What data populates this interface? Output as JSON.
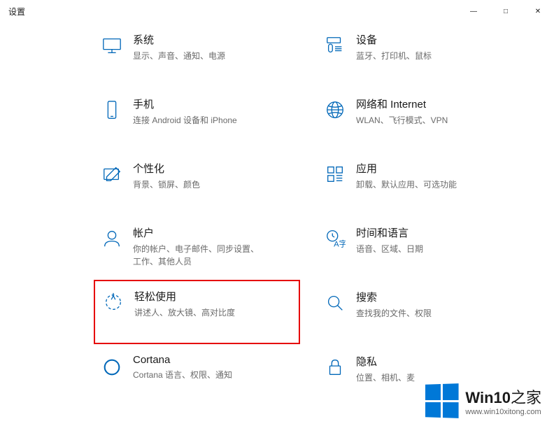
{
  "window_title": "设置",
  "window_controls": {
    "min": "—",
    "max": "□",
    "close": "✕"
  },
  "tiles": {
    "system": {
      "title": "系统",
      "desc": "显示、声音、通知、电源"
    },
    "devices": {
      "title": "设备",
      "desc": "蓝牙、打印机、鼠标"
    },
    "phone": {
      "title": "手机",
      "desc": "连接 Android 设备和 iPhone"
    },
    "network": {
      "title": "网络和 Internet",
      "desc": "WLAN、飞行模式、VPN"
    },
    "personalize": {
      "title": "个性化",
      "desc": "背景、锁屏、颜色"
    },
    "apps": {
      "title": "应用",
      "desc": "卸载、默认应用、可选功能"
    },
    "accounts": {
      "title": "帐户",
      "desc": "你的帐户、电子邮件、同步设置、工作、其他人员"
    },
    "time": {
      "title": "时间和语言",
      "desc": "语音、区域、日期"
    },
    "ease": {
      "title": "轻松使用",
      "desc": "讲述人、放大镜、高对比度"
    },
    "search": {
      "title": "搜索",
      "desc": "查找我的文件、权限"
    },
    "cortana": {
      "title": "Cortana",
      "desc": "Cortana 语言、权限、通知"
    },
    "privacy": {
      "title": "隐私",
      "desc": "位置、相机、麦"
    }
  },
  "watermark": {
    "brand": "Win10",
    "suffix": "之家",
    "url": "www.win10xitong.com"
  }
}
